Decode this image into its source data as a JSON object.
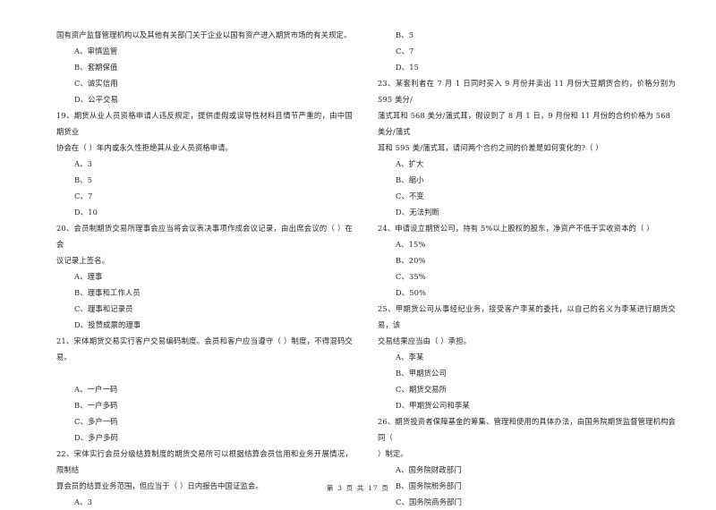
{
  "document": {
    "page_background": "#ffffff",
    "text_color": "#242424",
    "footer": "第 3 页  共 17 页"
  },
  "left_column": {
    "blocks": [
      {
        "type": "question_continuation",
        "lines": [
          "国有资产监督管理机构以及其他有关部门关于企业以国有资产进入期货市场的有关规定。"
        ]
      },
      {
        "type": "options",
        "items": [
          "A、审慎监管",
          "B、套期保值",
          "C、诚实信用",
          "D、公平交易"
        ]
      },
      {
        "type": "question",
        "number": "19",
        "lines": [
          "19、期货从业人员资格申请人违反规定，提供虚假或误导性材料且情节严重的，由中国期货业",
          "协会在（      ）年内或永久性拒绝其从业人员资格申请。"
        ]
      },
      {
        "type": "options",
        "items": [
          "A、3",
          "B、5",
          "C、7",
          "D、10"
        ]
      },
      {
        "type": "question",
        "number": "20",
        "lines": [
          "20、会员制期货交易所理事会应当将会议表决事项作成会议记录，由出席会议的（      ）在会",
          "议记录上签名。"
        ]
      },
      {
        "type": "options",
        "items": [
          "A、理事",
          "B、理事和工作人员",
          "C、理事和记录员",
          "D、投赞成票的理事"
        ]
      },
      {
        "type": "question",
        "number": "21",
        "lines": [
          "21、宋体期货交易实行客户交易编码制度。会员和客户应当遵守（      ）制度，不得混码交易。"
        ]
      },
      {
        "type": "options",
        "items": [
          "A、一户一码",
          "B、一户多码",
          "C、多户一码",
          "D、多户多码"
        ]
      },
      {
        "type": "question",
        "number": "22",
        "lines": [
          "22、宋体实行会员分级结算制度的期货交易所可以根据结算会员信用和业务开展情况，限制结",
          "算会员的结算业务范围，但应当于（      ）日内报告中国证监会。"
        ]
      },
      {
        "type": "options",
        "items": [
          "A、3"
        ]
      }
    ]
  },
  "right_column": {
    "blocks": [
      {
        "type": "options",
        "items": [
          "B、5",
          "C、7",
          "D、15"
        ]
      },
      {
        "type": "question",
        "number": "23",
        "lines": [
          "23、某套利者在 7 月 1 日同时买入 9 月份并卖出 11 月份大豆期货合约，价格分别为 595 美分/",
          "蒲式耳和 568 美分/蒲式耳，假设到了 8 月 1 日，9 月份和 11 月份的合约价格为 568 美分/蒲式",
          "耳和 595 美/蒲式耳，请问两个合约之间的价差是如何变化的?（      ）"
        ]
      },
      {
        "type": "options",
        "items": [
          "A、扩大",
          "B、缩小",
          "C、不变",
          "D、无法判断"
        ]
      },
      {
        "type": "question",
        "number": "24",
        "lines": [
          "24、申请设立期货公司，持有 5%以上股权的股东，净资产不低于实收资本的（      ）"
        ]
      },
      {
        "type": "options",
        "items": [
          "A、15%",
          "B、20%",
          "C、35%",
          "D、50%"
        ]
      },
      {
        "type": "question",
        "number": "25",
        "lines": [
          "25、甲期货公司从事经纪业务，接受客户李某的委托，以自己的名义为李某进行期货交易，该",
          "交易结果应当由（      ）承担。"
        ]
      },
      {
        "type": "options",
        "items": [
          "A、李某",
          "B、甲期货公司",
          "C、期货交易所",
          "D、甲期货公司和李某"
        ]
      },
      {
        "type": "question",
        "number": "26",
        "lines": [
          "26、期货投资者保障基金的筹集、管理和使用的具体办法，由国务院期货监督管理机构会同（",
          "）制定。"
        ]
      },
      {
        "type": "options",
        "items": [
          "A、国务院财政部门",
          "B、国务院税务部门",
          "C、国务院商务部门"
        ]
      }
    ]
  }
}
